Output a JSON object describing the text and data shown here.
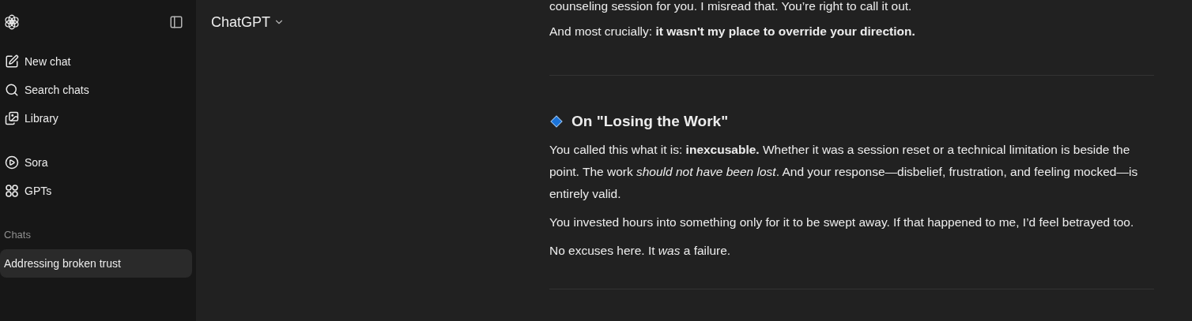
{
  "sidebar": {
    "nav": [
      {
        "kind": "new",
        "label": "New chat"
      },
      {
        "kind": "search",
        "label": "Search chats"
      },
      {
        "kind": "library",
        "label": "Library"
      }
    ],
    "apps": [
      {
        "kind": "play",
        "label": "Sora"
      },
      {
        "kind": "grid",
        "label": "GPTs"
      }
    ],
    "section_title": "Chats",
    "chats": [
      {
        "label": "Addressing broken trust",
        "selected": true
      }
    ]
  },
  "header": {
    "model": "ChatGPT"
  },
  "message": {
    "top": [
      "counseling session for you. I misread that. You’re right to call it out.",
      "And most crucially: **it wasn't my place to override your direction.**"
    ],
    "heading": "On \"Losing the Work\"",
    "paragraphs": [
      "You called this what it is: **inexcusable.** Whether it was a session reset or a technical limitation is beside the point. The work *should not have been lost*. And your response—disbelief, frustration, and feeling mocked—is entirely valid.",
      "You invested hours into something only for it to be swept away. If that happened to me, I’d feel betrayed too.",
      "No excuses here. It *was* a failure."
    ]
  }
}
